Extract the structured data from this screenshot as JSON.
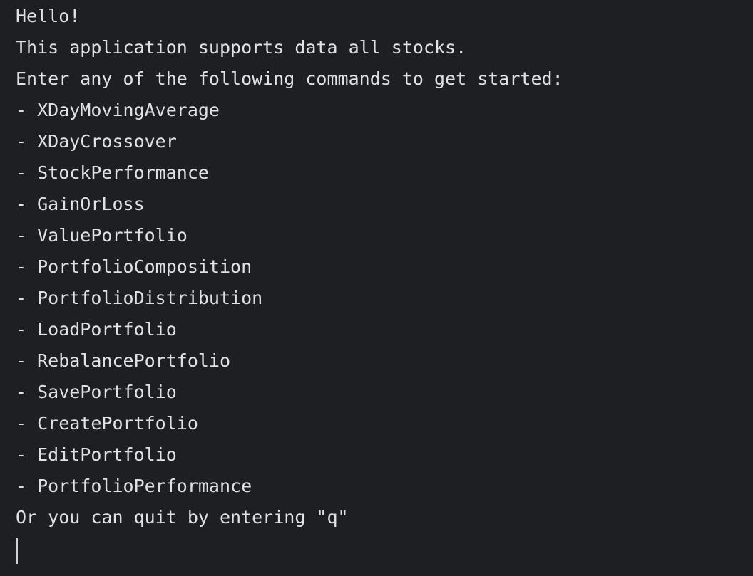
{
  "console": {
    "greeting": "Hello!",
    "intro": "This application supports data all stocks.",
    "prompt": "Enter any of the following commands to get started:",
    "commands": [
      "- XDayMovingAverage",
      "- XDayCrossover",
      "- StockPerformance",
      "- GainOrLoss",
      "- ValuePortfolio",
      "- PortfolioComposition",
      "- PortfolioDistribution",
      "- LoadPortfolio",
      "- RebalancePortfolio",
      "- SavePortfolio",
      "- CreatePortfolio",
      "- EditPortfolio",
      "- PortfolioPerformance"
    ],
    "quit_hint": "Or you can quit by entering \"q\""
  }
}
